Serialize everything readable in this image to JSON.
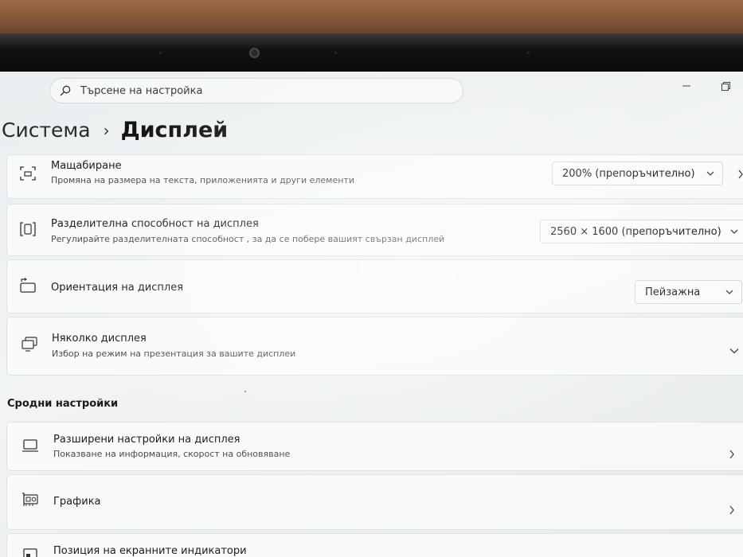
{
  "search": {
    "placeholder": "Търсене на настройка"
  },
  "breadcrumb": {
    "parent": "Система",
    "separator": "›",
    "current": "Дисплей"
  },
  "cards": {
    "scale": {
      "title": "Мащабиране",
      "subtitle": "Промяна на размера на текста, приложенията и други елементи",
      "value": "200% (препоръчително)",
      "icon": "scale-icon"
    },
    "resolution": {
      "title": "Разделителна способност на дисплея",
      "subtitle": "Регулирайте разделителната способност , за да се побере вашият свързан дисплей",
      "value": "2560 × 1600 (препоръчително)",
      "icon": "resolution-icon"
    },
    "orientation": {
      "title": "Ориентация на дисплея",
      "value": "Пейзажна",
      "icon": "orientation-icon"
    },
    "multiple": {
      "title": "Няколко дисплея",
      "subtitle": "Избор на режим на презентация за вашите дисплеи",
      "icon": "multiple-displays-icon"
    }
  },
  "related": {
    "title": "Сродни настройки",
    "items": [
      {
        "title": "Разширени настройки на дисплея",
        "subtitle": "Показване на информация, скорост на обновяване",
        "icon": "monitor-icon"
      },
      {
        "title": "Графика",
        "icon": "graphics-card-icon"
      },
      {
        "title": "Позиция на екранните индикатори",
        "icon": "indicator-icon"
      }
    ]
  }
}
